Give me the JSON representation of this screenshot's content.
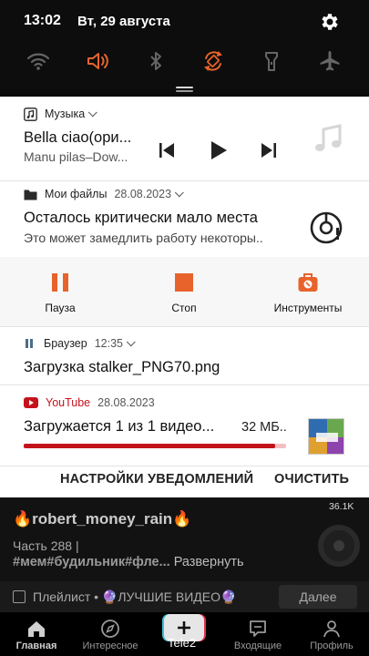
{
  "status_bar": {
    "time": "13:02",
    "date": "Вт, 29 августа"
  },
  "quick_settings": [
    "wifi-icon",
    "sound-icon",
    "bluetooth-icon",
    "auto-rotate-icon",
    "flashlight-icon",
    "airplane-mode-icon"
  ],
  "colors": {
    "accent_orange": "#e8632b",
    "youtube_red": "#c4121c"
  },
  "music": {
    "app": "Музыка",
    "title": "Bella ciao(ори...",
    "artist": "Manu pilas–Dow..."
  },
  "files": {
    "app": "Мои файлы",
    "time": "28.08.2023",
    "title": "Осталось критически мало места",
    "text": "Это может замедлить работу некоторы..",
    "actions": {
      "pause": "Пауза",
      "stop": "Стоп",
      "tools": "Инструменты"
    }
  },
  "browser": {
    "app": "Браузер",
    "time": "12:35",
    "title": "Загрузка stalker_PNG70.png"
  },
  "youtube": {
    "app": "YouTube",
    "time": "28.08.2023",
    "title": "Загружается 1 из 1 видео...",
    "size": "32 МБ..",
    "progress": 0.96
  },
  "footer": {
    "settings": "НАСТРОЙКИ УВЕДОМЛЕНИЙ",
    "clear": "ОЧИСТИТЬ"
  },
  "background_app": {
    "views": "36.1K",
    "author": "🔥robert_money_rain🔥",
    "part": "Часть 288 |",
    "tags": "#мем#будильник#фле...",
    "expand": "Развернуть",
    "playlist": "Плейлист • 🔮ЛУЧШИЕ ВИДЕО🔮",
    "more": "Далее",
    "nav": {
      "home": "Главная",
      "discover": "Интересное",
      "create": "Tele2",
      "inbox": "Входящие",
      "profile": "Профиль"
    }
  }
}
